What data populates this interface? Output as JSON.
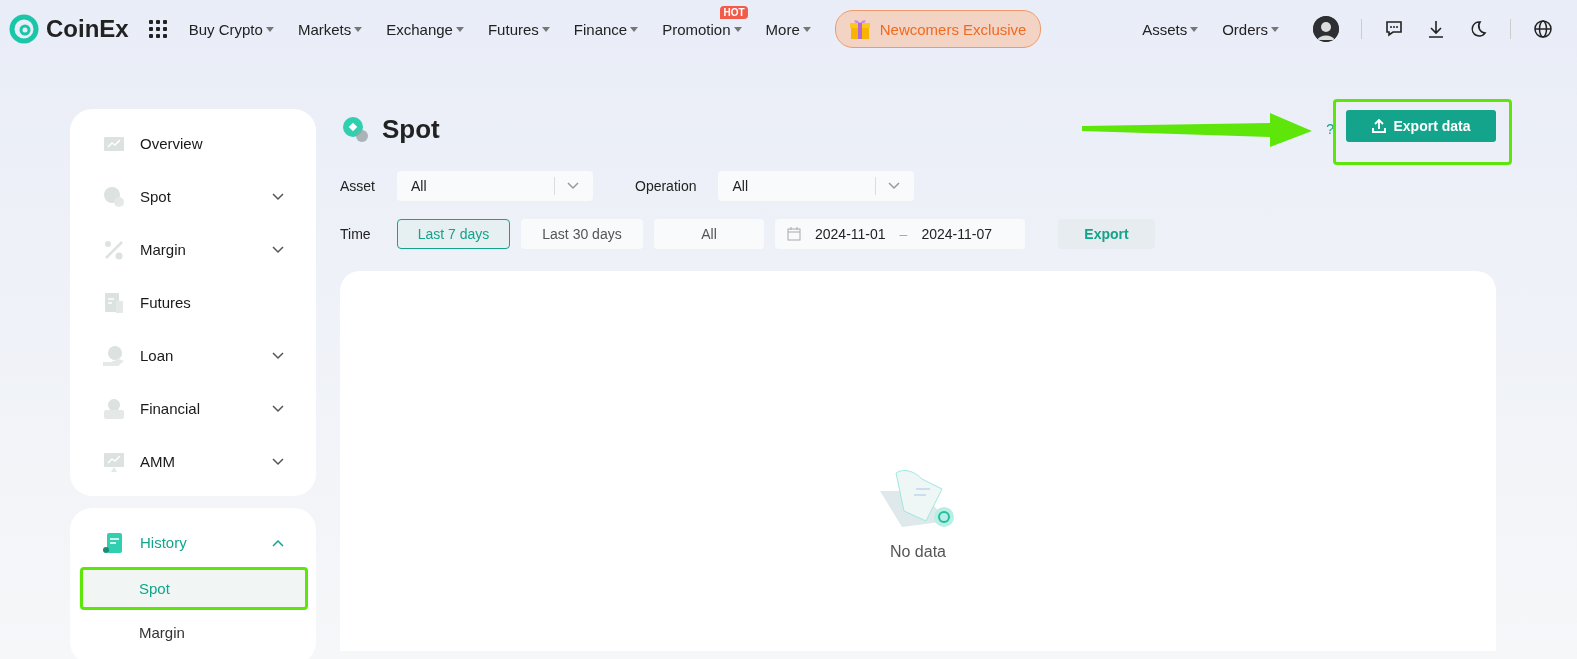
{
  "nav": {
    "logo": "CoinEx",
    "menu": [
      {
        "label": "Buy Crypto"
      },
      {
        "label": "Markets"
      },
      {
        "label": "Exchange"
      },
      {
        "label": "Futures"
      },
      {
        "label": "Finance"
      },
      {
        "label": "Promotion",
        "badge": "HOT"
      },
      {
        "label": "More"
      }
    ],
    "promo": "Newcomers Exclusive",
    "right_menu": [
      {
        "label": "Assets"
      },
      {
        "label": "Orders"
      }
    ]
  },
  "sidebar": {
    "items": [
      {
        "label": "Overview",
        "expandable": false
      },
      {
        "label": "Spot",
        "expandable": true
      },
      {
        "label": "Margin",
        "expandable": true
      },
      {
        "label": "Futures",
        "expandable": false
      },
      {
        "label": "Loan",
        "expandable": true
      },
      {
        "label": "Financial",
        "expandable": true
      },
      {
        "label": "AMM",
        "expandable": true
      }
    ],
    "history": {
      "label": "History",
      "expanded": true,
      "children": [
        {
          "label": "Spot",
          "selected": true
        },
        {
          "label": "Margin",
          "selected": false
        }
      ]
    }
  },
  "page": {
    "title": "Spot",
    "help": "?",
    "export_button": "Export data",
    "filters": {
      "asset_label": "Asset",
      "asset_value": "All",
      "operation_label": "Operation",
      "operation_value": "All",
      "time_label": "Time",
      "ranges": [
        {
          "label": "Last 7 days",
          "selected": true
        },
        {
          "label": "Last 30 days",
          "selected": false
        },
        {
          "label": "All",
          "selected": false
        }
      ],
      "date_start": "2024-11-01",
      "date_sep": "–",
      "date_end": "2024-11-07",
      "export": "Export"
    },
    "empty": "No data"
  }
}
